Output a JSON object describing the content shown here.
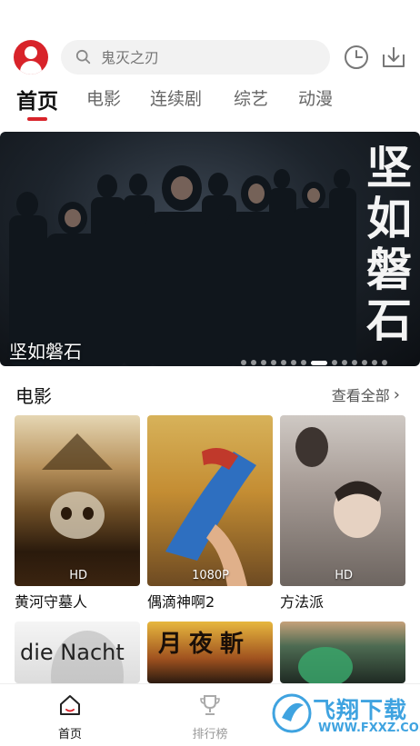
{
  "search": {
    "placeholder": "鬼灭之刃"
  },
  "tabs": [
    {
      "label": "首页",
      "active": true
    },
    {
      "label": "电影"
    },
    {
      "label": "连续剧"
    },
    {
      "label": "综艺"
    },
    {
      "label": "动漫"
    }
  ],
  "banner": {
    "title": "坚如磐石",
    "poster_calligraphy": "坚如磐石",
    "slide_count": 14,
    "active_slide": 7
  },
  "section": {
    "title": "电影",
    "see_all": "查看全部",
    "see_all_chevron": "›"
  },
  "movies": [
    {
      "title": "黄河守墓人",
      "badge": "HD"
    },
    {
      "title": "偶滴神啊2",
      "badge": "1080P"
    },
    {
      "title": "方法派",
      "badge": "HD"
    },
    {
      "title": "",
      "poster_text": "die Nacht"
    },
    {
      "title": "",
      "poster_text": "月夜斬"
    },
    {
      "title": ""
    }
  ],
  "bottom_nav": [
    {
      "label": "首页",
      "icon": "home-icon",
      "active": true
    },
    {
      "label": "排行榜",
      "icon": "trophy-icon"
    }
  ],
  "watermark": {
    "text": "飞翔下载",
    "url": "WWW.FXXZ.COM"
  },
  "colors": {
    "accent": "#d8232a",
    "watermark": "#3fa3e0"
  }
}
